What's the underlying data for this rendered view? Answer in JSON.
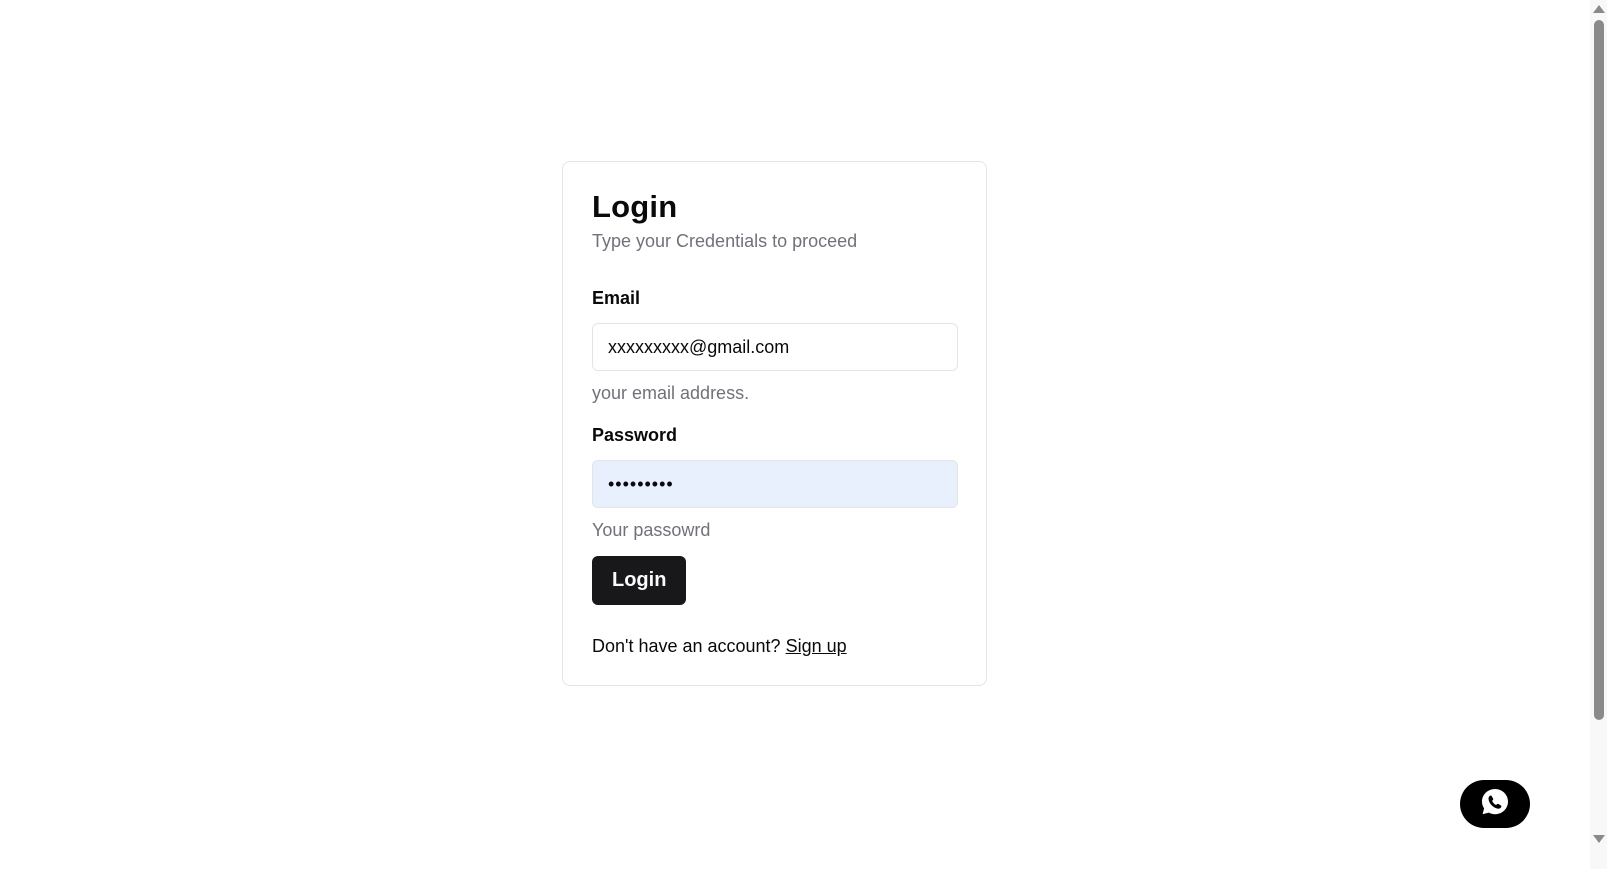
{
  "login": {
    "title": "Login",
    "subtitle": "Type your Credentials to proceed",
    "email": {
      "label": "Email",
      "value": "xxxxxxxxx@gmail.com",
      "hint": "your email address."
    },
    "password": {
      "label": "Password",
      "value": "•••••••••",
      "hint": "Your passowrd"
    },
    "submit_label": "Login",
    "signup_prompt": "Don't have an account?",
    "signup_link": "Sign up"
  },
  "icons": {
    "chat": "whatsapp-icon"
  },
  "colors": {
    "button_bg": "#18181b",
    "autofill_bg": "#e8f0fe",
    "muted_text": "#71717a",
    "chat_button_bg": "#000000"
  }
}
